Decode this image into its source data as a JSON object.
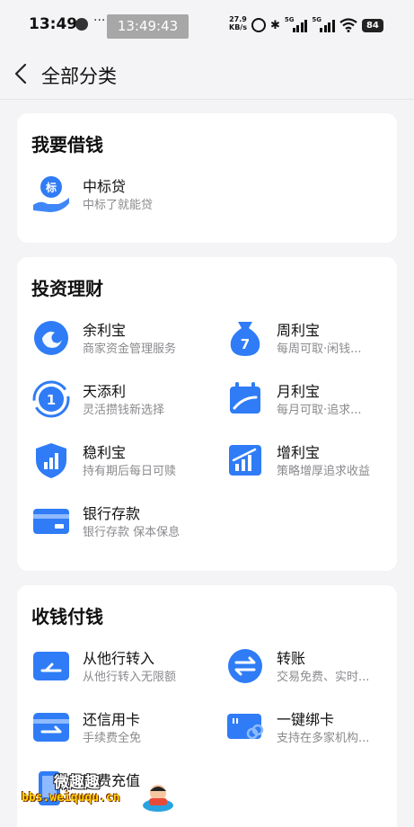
{
  "status": {
    "time": "13:49",
    "more": "···",
    "clock_overlay": "13:49:43",
    "speed_value": "27.9",
    "speed_unit": "KB/s",
    "net1": "5G",
    "net2": "5G",
    "battery": "84"
  },
  "nav": {
    "title": "全部分类"
  },
  "sections": {
    "borrow": {
      "title": "我要借钱",
      "items": [
        {
          "name": "中标贷",
          "desc": "中标了就能贷",
          "icon": "hand-coin-icon"
        }
      ]
    },
    "invest": {
      "title": "投资理财",
      "items": [
        {
          "name": "余利宝",
          "desc": "商家资金管理服务",
          "icon": "wave-coin-icon"
        },
        {
          "name": "周利宝",
          "desc": "每周可取·闲钱...",
          "icon": "money-bag-icon",
          "badge": "7"
        },
        {
          "name": "天添利",
          "desc": "灵活攒钱新选择",
          "icon": "daily-cycle-icon",
          "badge": "1"
        },
        {
          "name": "月利宝",
          "desc": "每月可取·追求...",
          "icon": "calendar-icon"
        },
        {
          "name": "稳利宝",
          "desc": "持有期后每日可赎",
          "icon": "shield-chart-icon"
        },
        {
          "name": "增利宝",
          "desc": "策略增厚追求收益",
          "icon": "growth-chart-icon"
        },
        {
          "name": "银行存款",
          "desc": "银行存款 保本保息",
          "icon": "bank-card-icon"
        }
      ]
    },
    "payments": {
      "title": "收钱付钱",
      "items": [
        {
          "name": "从他行转入",
          "desc": "从他行转入无限额",
          "icon": "transfer-in-icon"
        },
        {
          "name": "转账",
          "desc": "交易免费、实时...",
          "icon": "exchange-icon"
        },
        {
          "name": "还信用卡",
          "desc": "手续费全免",
          "icon": "credit-card-icon"
        },
        {
          "name": "一键绑卡",
          "desc": "支持在多家机构...",
          "icon": "link-card-icon"
        },
        {
          "name": "话费充值",
          "desc": "",
          "icon": "phone-icon"
        }
      ]
    }
  },
  "watermark": {
    "text": "微趣趣",
    "url": "bbs.weiququ.cn"
  },
  "colors": {
    "accent": "#2f7cf6",
    "background": "#f4f4f6",
    "card": "#ffffff",
    "subtext": "#8a8a8e"
  }
}
